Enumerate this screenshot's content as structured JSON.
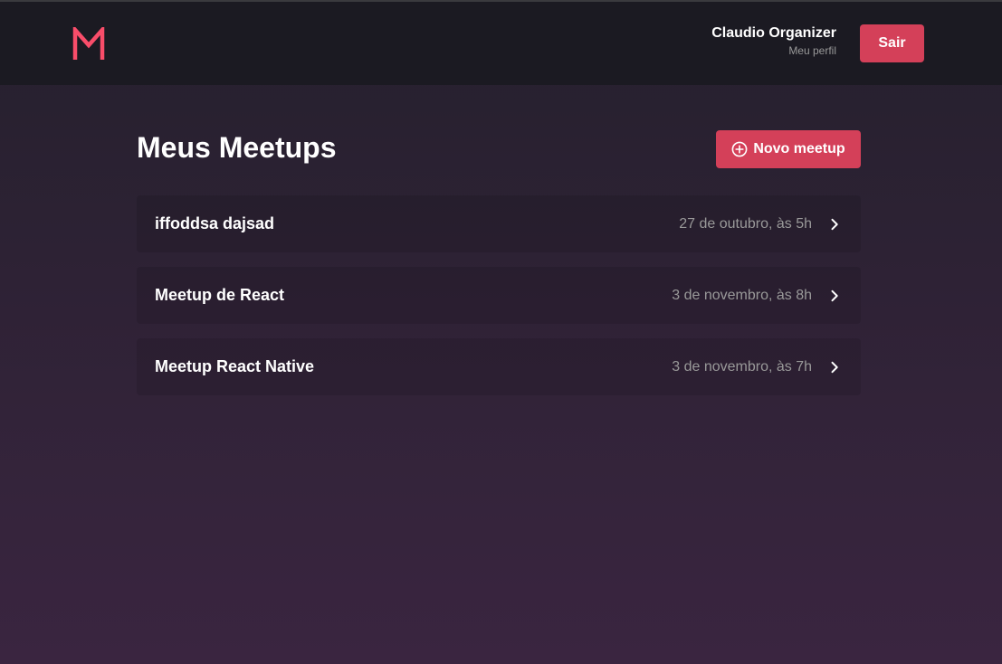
{
  "header": {
    "profile_name": "Claudio Organizer",
    "profile_link": "Meu perfil",
    "logout_label": "Sair"
  },
  "main": {
    "title": "Meus Meetups",
    "new_button_label": "Novo meetup",
    "meetups": [
      {
        "title": "iffoddsa dajsad",
        "date": "27 de outubro, às 5h"
      },
      {
        "title": "Meetup de React",
        "date": "3 de novembro, às 8h"
      },
      {
        "title": "Meetup React Native",
        "date": "3 de novembro, às 7h"
      }
    ]
  },
  "icons": {
    "logo": "m-logo-icon",
    "new": "plus-circle-icon",
    "row_action": "chevron-right-icon"
  },
  "colors": {
    "accent": "#d44059",
    "logo": "#f94d6a",
    "header_bg": "#1b1a22"
  }
}
